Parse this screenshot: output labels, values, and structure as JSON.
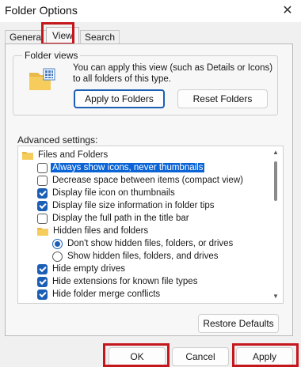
{
  "window": {
    "title": "Folder Options",
    "close_glyph": "✕"
  },
  "tabs": [
    {
      "label": "General",
      "active": false
    },
    {
      "label": "View",
      "active": true
    },
    {
      "label": "Search",
      "active": false
    }
  ],
  "folder_views": {
    "group_label": "Folder views",
    "description": "You can apply this view (such as Details or Icons) to all folders of this type.",
    "apply_button": "Apply to Folders",
    "reset_button": "Reset Folders",
    "icon": "folder-view-icon"
  },
  "advanced": {
    "label": "Advanced settings:",
    "items": [
      {
        "type": "folder",
        "label": "Files and Folders",
        "icon": "folder-icon"
      },
      {
        "type": "checkbox",
        "label": "Always show icons, never thumbnails",
        "checked": false,
        "selected": true
      },
      {
        "type": "checkbox",
        "label": "Decrease space between items (compact view)",
        "checked": false
      },
      {
        "type": "checkbox",
        "label": "Display file icon on thumbnails",
        "checked": true
      },
      {
        "type": "checkbox",
        "label": "Display file size information in folder tips",
        "checked": true
      },
      {
        "type": "checkbox",
        "label": "Display the full path in the title bar",
        "checked": false
      },
      {
        "type": "folder",
        "label": "Hidden files and folders",
        "icon": "folder-icon"
      },
      {
        "type": "radio",
        "label": "Don't show hidden files, folders, or drives",
        "checked": true
      },
      {
        "type": "radio",
        "label": "Show hidden files, folders, and drives",
        "checked": false
      },
      {
        "type": "checkbox",
        "label": "Hide empty drives",
        "checked": true
      },
      {
        "type": "checkbox",
        "label": "Hide extensions for known file types",
        "checked": true
      },
      {
        "type": "checkbox",
        "label": "Hide folder merge conflicts",
        "checked": true
      }
    ]
  },
  "restore_defaults": "Restore Defaults",
  "footer": {
    "ok": "OK",
    "cancel": "Cancel",
    "apply": "Apply"
  },
  "colors": {
    "accent": "#1b5fb5",
    "highlight_box": "#c4171d",
    "selection": "#0b64d6"
  }
}
